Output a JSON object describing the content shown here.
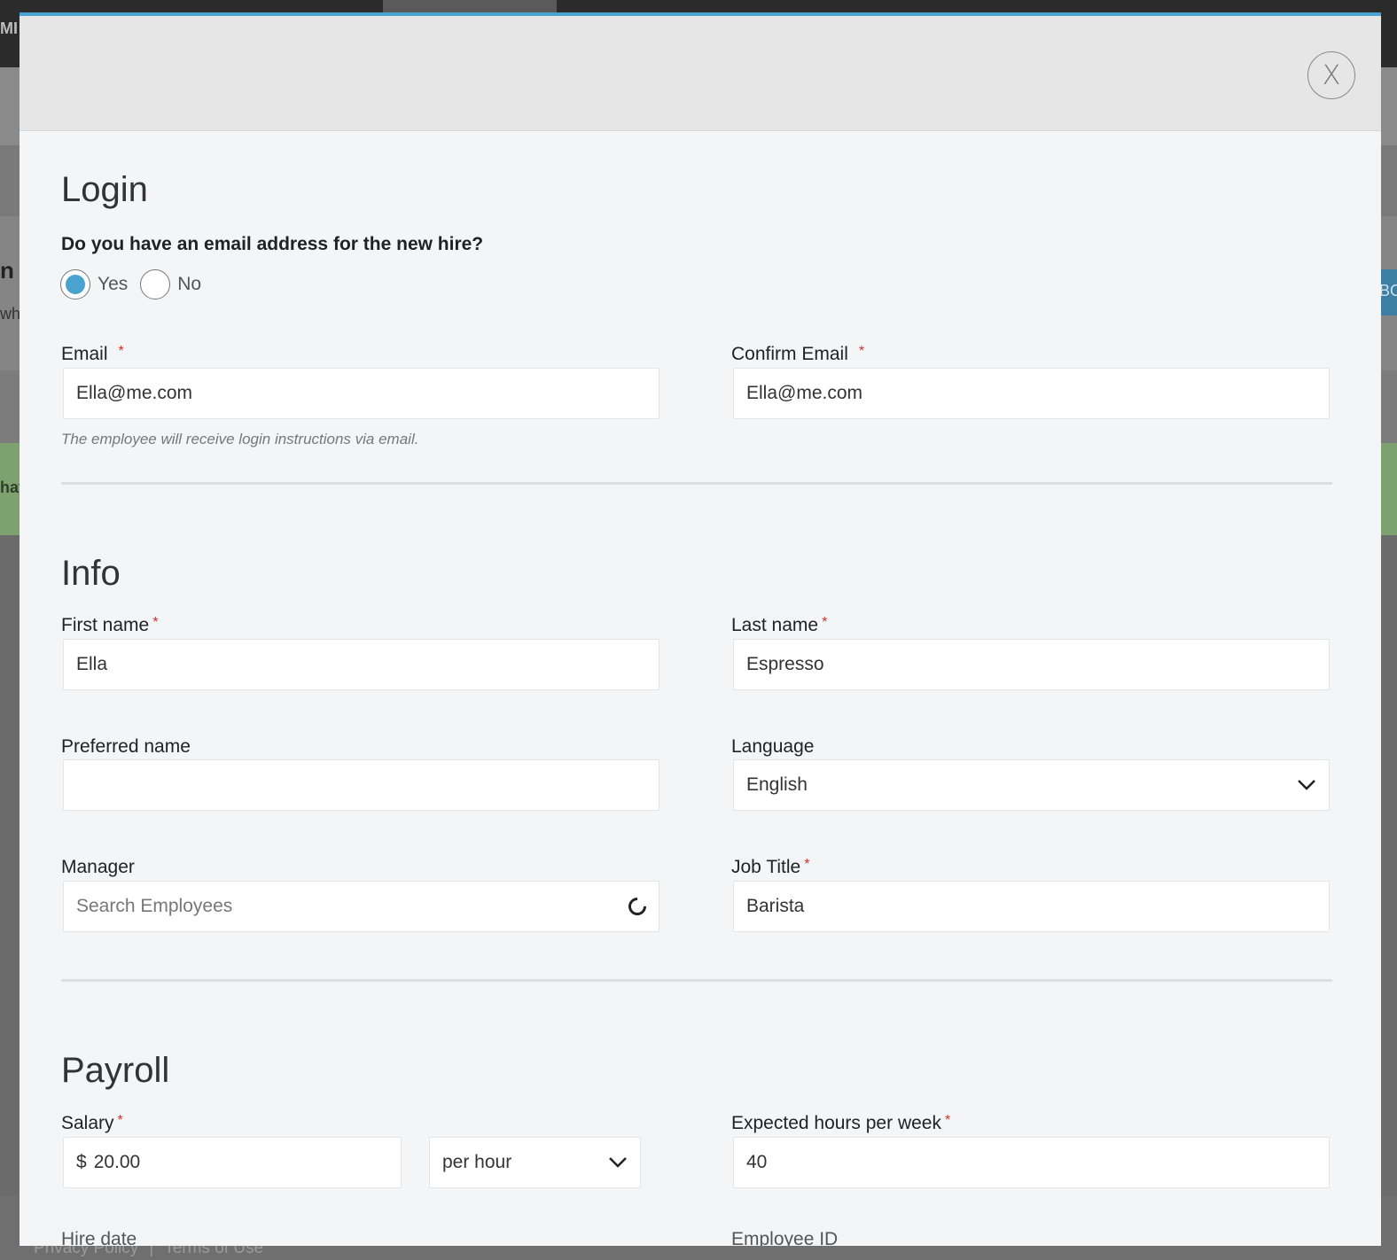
{
  "background": {
    "logo_text": "MI",
    "peek_heading": "n",
    "peek_subtext": "wh",
    "peek_banner": "hav",
    "peek_button": "BO",
    "footer": {
      "privacy": "Privacy Policy",
      "separator": "|",
      "terms": "Terms of Use"
    }
  },
  "modal": {
    "close_label": "X",
    "login": {
      "title": "Login",
      "question": "Do you have an email address for the new hire?",
      "radio_yes": "Yes",
      "radio_no": "No",
      "selected": "Yes",
      "email_label": "Email",
      "email_value": "Ella@me.com",
      "confirm_email_label": "Confirm Email",
      "confirm_email_value": "Ella@me.com",
      "helper_text": "The employee will receive login instructions via email.",
      "required_mark": "*"
    },
    "info": {
      "title": "Info",
      "first_name_label": "First name",
      "first_name_value": "Ella",
      "last_name_label": "Last name",
      "last_name_value": "Espresso",
      "preferred_name_label": "Preferred name",
      "preferred_name_value": "",
      "language_label": "Language",
      "language_value": "English",
      "manager_label": "Manager",
      "manager_placeholder": "Search Employees",
      "job_title_label": "Job Title",
      "job_title_value": "Barista"
    },
    "payroll": {
      "title": "Payroll",
      "salary_label": "Salary",
      "salary_prefix": "$",
      "salary_value": "20.00",
      "salary_period": "per hour",
      "hours_label": "Expected hours per week",
      "hours_value": "40",
      "cut_label_left": "Hire date",
      "cut_label_right": "Employee ID"
    }
  },
  "colors": {
    "accent": "#4aa3cf",
    "required": "#d0312d",
    "modal_bg": "#f4f5f7",
    "header_bg": "#e6e6e6"
  }
}
